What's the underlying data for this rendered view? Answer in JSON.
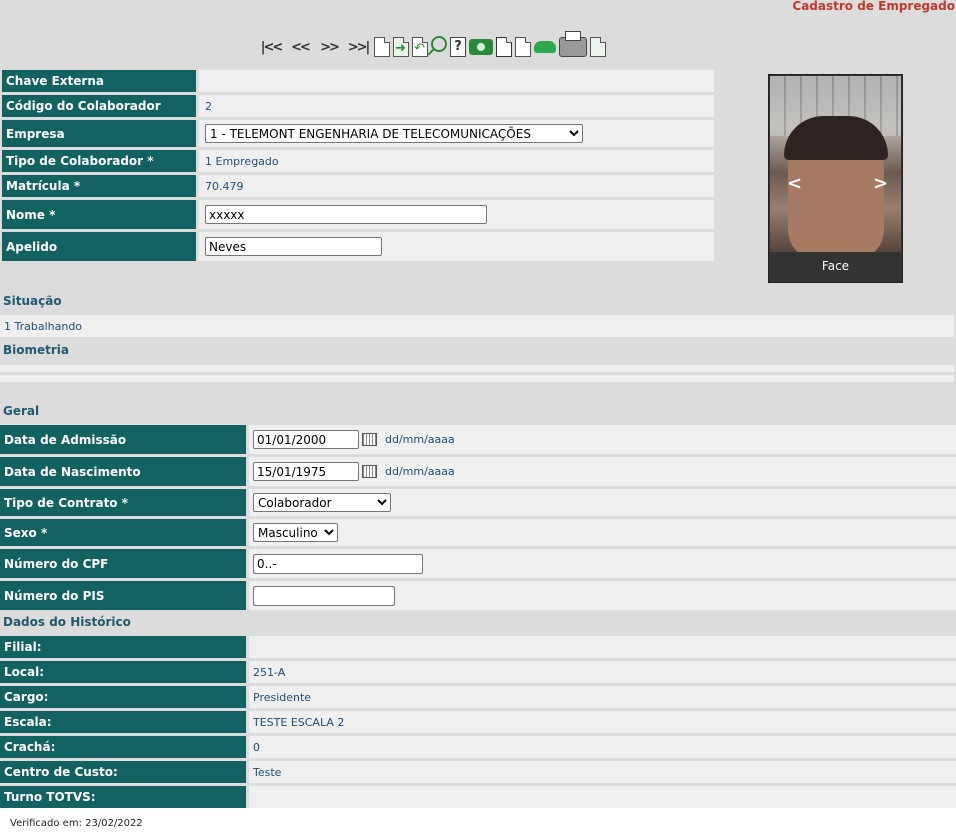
{
  "page": {
    "title": "Cadastro de Empregado"
  },
  "toolbar": {
    "nav_first": "|<<",
    "nav_prev": "<<",
    "nav_next": ">>",
    "nav_last": ">>|",
    "help_glyph": "?"
  },
  "form": {
    "chave_externa": {
      "label": "Chave Externa",
      "value": ""
    },
    "codigo": {
      "label": "Código do Colaborador",
      "value": "2"
    },
    "empresa": {
      "label": "Empresa",
      "value": "1 - TELEMONT ENGENHARIA DE TELECOMUNICAÇÕES"
    },
    "tipo_colaborador": {
      "label": "Tipo de Colaborador *",
      "value": "1 Empregado"
    },
    "matricula": {
      "label": "Matrícula *",
      "value": "70.479"
    },
    "nome": {
      "label": "Nome *",
      "value": "xxxxx"
    },
    "apelido": {
      "label": "Apelido",
      "value": "Neves"
    }
  },
  "photo": {
    "prev": "<",
    "next": ">",
    "caption": "Face"
  },
  "situacao": {
    "title": "Situação",
    "value": "1 Trabalhando"
  },
  "biometria": {
    "title": "Biometria"
  },
  "geral": {
    "title": "Geral",
    "admissao": {
      "label": "Data de Admissão",
      "value": "01/01/2000",
      "hint": "dd/mm/aaaa"
    },
    "nascimento": {
      "label": "Data de Nascimento",
      "value": "15/01/1975",
      "hint": "dd/mm/aaaa"
    },
    "tipo_contrato": {
      "label": "Tipo de Contrato *",
      "value": "Colaborador"
    },
    "sexo": {
      "label": "Sexo *",
      "value": "Masculino"
    },
    "cpf": {
      "label": "Número do CPF",
      "value": "0..-"
    },
    "pis": {
      "label": "Número do PIS",
      "value": ""
    }
  },
  "historico": {
    "title": "Dados do Histórico",
    "rows": [
      {
        "label": "Filial:",
        "value": ""
      },
      {
        "label": "Local:",
        "value": "251-A"
      },
      {
        "label": "Cargo:",
        "value": "Presidente"
      },
      {
        "label": "Escala:",
        "value": "TESTE ESCALA 2"
      },
      {
        "label": "Crachá:",
        "value": "0"
      },
      {
        "label": "Centro de Custo:",
        "value": "Teste"
      },
      {
        "label": "Turno TOTVS:",
        "value": ""
      }
    ]
  },
  "footer": {
    "verified": "Verificado em: 23/02/2022"
  }
}
